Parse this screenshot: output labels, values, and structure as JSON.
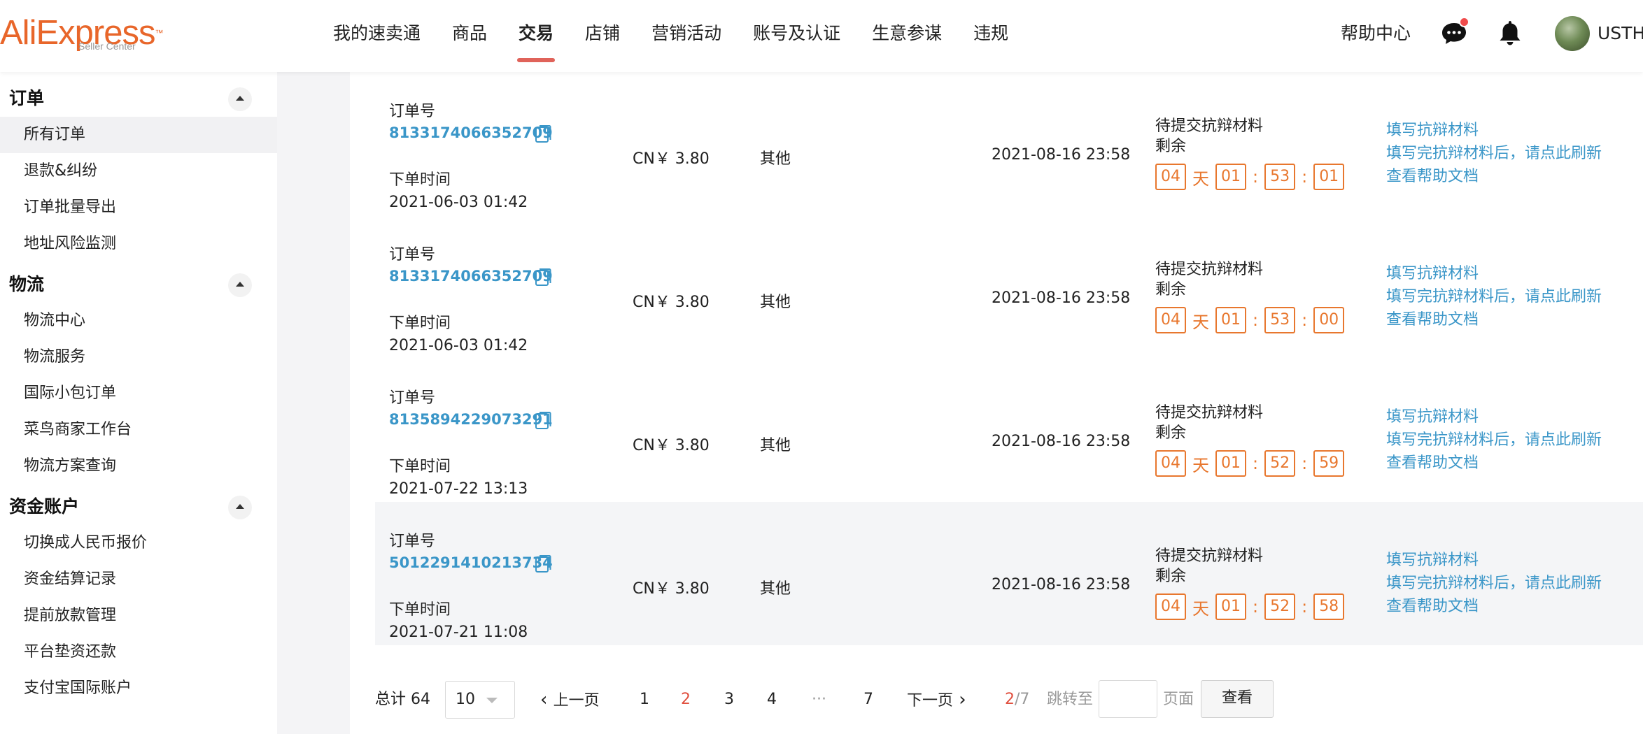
{
  "header": {
    "logo_main": "AliExpress",
    "logo_sub": "Seller Center",
    "nav": [
      "我的速卖通",
      "商品",
      "交易",
      "店铺",
      "营销活动",
      "账号及认证",
      "生意参谋",
      "违规"
    ],
    "active_nav": "交易",
    "help": "帮助中心",
    "user": "USTH",
    "accent_color": "#e8662a"
  },
  "sidebar": {
    "sections": [
      {
        "title": "订单",
        "items": [
          "所有订单",
          "退款&纠纷",
          "订单批量导出",
          "地址风险监测"
        ]
      },
      {
        "title": "物流",
        "items": [
          "物流中心",
          "物流服务",
          "国际小包订单",
          "菜鸟商家工作台",
          "物流方案查询"
        ]
      },
      {
        "title": "资金账户",
        "items": [
          "切换成人民币报价",
          "资金结算记录",
          "提前放款管理",
          "平台垫资还款",
          "支付宝国际账户"
        ]
      }
    ],
    "active_item": "所有订单"
  },
  "orders": {
    "order_no_label": "订单号",
    "order_time_label": "下单时间",
    "rows": [
      {
        "order_no": "8133174066352709",
        "order_time": "2021-06-03 01:42",
        "amount": "CN￥ 3.80",
        "type": "其他",
        "deadline": "2021-08-16 23:58",
        "status": "待提交抗辩材料",
        "remain": "剩余",
        "days": "04",
        "day_unit": "天",
        "h": "01",
        "m": "53",
        "s": "01",
        "actions": [
          "填写抗辩材料",
          "填写完抗辩材料后，请点此刷新",
          "查看帮助文档"
        ]
      },
      {
        "order_no": "8133174066352709",
        "order_time": "2021-06-03 01:42",
        "amount": "CN￥ 3.80",
        "type": "其他",
        "deadline": "2021-08-16 23:58",
        "status": "待提交抗辩材料",
        "remain": "剩余",
        "days": "04",
        "day_unit": "天",
        "h": "01",
        "m": "53",
        "s": "00",
        "actions": [
          "填写抗辩材料",
          "填写完抗辩材料后，请点此刷新",
          "查看帮助文档"
        ]
      },
      {
        "order_no": "8135894229073291",
        "order_time": "2021-07-22 13:13",
        "amount": "CN￥ 3.80",
        "type": "其他",
        "deadline": "2021-08-16 23:58",
        "status": "待提交抗辩材料",
        "remain": "剩余",
        "days": "04",
        "day_unit": "天",
        "h": "01",
        "m": "52",
        "s": "59",
        "actions": [
          "填写抗辩材料",
          "填写完抗辩材料后，请点此刷新",
          "查看帮助文档"
        ]
      },
      {
        "order_no": "5012291410213734",
        "order_time": "2021-07-21 11:08",
        "amount": "CN￥ 3.80",
        "type": "其他",
        "deadline": "2021-08-16 23:58",
        "status": "待提交抗辩材料",
        "remain": "剩余",
        "days": "04",
        "day_unit": "天",
        "h": "01",
        "m": "52",
        "s": "58",
        "actions": [
          "填写抗辩材料",
          "填写完抗辩材料后，请点此刷新",
          "查看帮助文档"
        ]
      }
    ]
  },
  "pagination": {
    "total": "总计 64",
    "page_size": "10",
    "prev": "上一页",
    "pages": [
      "1",
      "2",
      "3",
      "4",
      "···",
      "7"
    ],
    "current_page": "2",
    "next": "下一页",
    "current": "2",
    "total_pages": "/7",
    "jump_label": "跳转至",
    "page_unit": "页面",
    "go": "查看"
  }
}
